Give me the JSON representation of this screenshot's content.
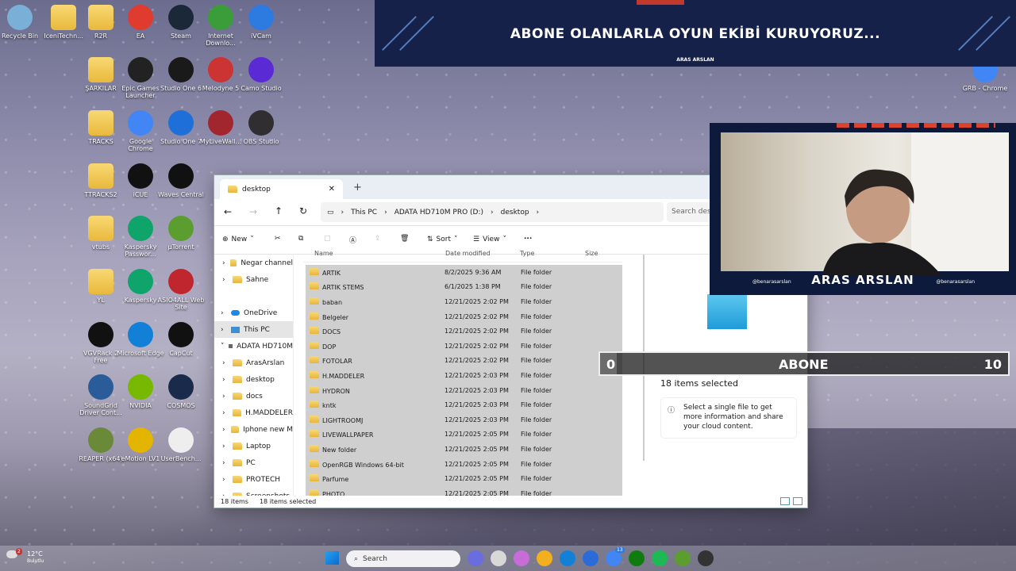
{
  "desktop_icons": [
    {
      "label": "Recycle Bin",
      "color": "#7ab0d8"
    },
    {
      "label": "IceniTechn...",
      "color": "folder"
    },
    {
      "label": "R2R",
      "color": "folder"
    },
    {
      "label": "EA",
      "color": "#e03b2f"
    },
    {
      "label": "Steam",
      "color": "#1b2838"
    },
    {
      "label": "Internet Downlo...",
      "color": "#3a9d3a"
    },
    {
      "label": "iVCam",
      "color": "#2d7be0"
    },
    {
      "label": "ŞARKILAR",
      "color": "folder"
    },
    {
      "label": "Epic Games Launcher",
      "color": "#222222"
    },
    {
      "label": "Studio One 6",
      "color": "#1a1a1a"
    },
    {
      "label": "Melodyne 5",
      "color": "#c33"
    },
    {
      "label": "Camo Studio",
      "color": "#5a2bd4"
    },
    {
      "label": "TRACKS",
      "color": "folder"
    },
    {
      "label": "Google Chrome",
      "color": "#4285f4"
    },
    {
      "label": "Studio One 7",
      "color": "#1e6fd8"
    },
    {
      "label": "MyLiveWall...",
      "color": "#a2262d"
    },
    {
      "label": "OBS Studio",
      "color": "#302e31"
    },
    {
      "label": "TTRACKS2",
      "color": "folder"
    },
    {
      "label": "iCUE",
      "color": "#111111"
    },
    {
      "label": "Waves Central",
      "color": "#111111"
    },
    {
      "label": "vtubs",
      "color": "folder"
    },
    {
      "label": "Kaspersky Passwor...",
      "color": "#0ea46a"
    },
    {
      "label": "µTorrent",
      "color": "#5b9e2f"
    },
    {
      "label": "YL",
      "color": "folder"
    },
    {
      "label": "Kaspersky",
      "color": "#0ea46a"
    },
    {
      "label": "ASIO4ALL Web Site",
      "color": "#c0262d"
    },
    {
      "label": "VGVRack 2 Free",
      "color": "#111111"
    },
    {
      "label": "Microsoft Edge",
      "color": "#1380d8"
    },
    {
      "label": "CapCut",
      "color": "#111111"
    },
    {
      "label": "SoundGrid Driver Cont...",
      "color": "#2a5c9a"
    },
    {
      "label": "NVIDIA",
      "color": "#76b900"
    },
    {
      "label": "COSMOS",
      "color": "#1a2a4a"
    },
    {
      "label": "REAPER (x64)",
      "color": "#6a8a3a"
    },
    {
      "label": "eMotion LV1",
      "color": "#e3b400"
    },
    {
      "label": "UserBench...",
      "color": "#eeeeee"
    },
    {
      "label": "GRB - Chrome",
      "color": "#4285f4"
    }
  ],
  "banner": {
    "text": "ABONE OLANLARLA OYUN EKİBİ KURUYORUZ...",
    "name": "ARAS ARSLAN"
  },
  "explorer": {
    "tab_title": "desktop",
    "breadcrumb": [
      "This PC",
      "ADATA HD710M PRO (D:)",
      "desktop"
    ],
    "search_placeholder": "Search desk",
    "toolbar": {
      "new": "New",
      "sort": "Sort",
      "view": "View",
      "more": "..."
    },
    "columns": [
      "Name",
      "Date modified",
      "Type",
      "Size"
    ],
    "sidebar": [
      {
        "label": "Negar channel",
        "indent": 1
      },
      {
        "label": "Sahne",
        "indent": 1
      },
      {
        "label": "",
        "indent": 0
      },
      {
        "label": "OneDrive",
        "indent": 0,
        "icon": "cloud"
      },
      {
        "label": "This PC",
        "indent": 0,
        "icon": "pc",
        "selected": true
      },
      {
        "label": "ADATA HD710M",
        "indent": 0,
        "icon": "drive",
        "expanded": true
      },
      {
        "label": "ArasArslan",
        "indent": 1
      },
      {
        "label": "desktop",
        "indent": 1
      },
      {
        "label": "docs",
        "indent": 1
      },
      {
        "label": "H.MADDELER",
        "indent": 1
      },
      {
        "label": "Iphone new M",
        "indent": 1
      },
      {
        "label": "Laptop",
        "indent": 1
      },
      {
        "label": "PC",
        "indent": 1
      },
      {
        "label": "PROTECH",
        "indent": 1
      },
      {
        "label": "Screenshots",
        "indent": 1
      }
    ],
    "rows": [
      {
        "name": "ARTIK",
        "date": "8/2/2025 9:36 AM",
        "type": "File folder"
      },
      {
        "name": "ARTIK STEMS",
        "date": "6/1/2025 1:38 PM",
        "type": "File folder"
      },
      {
        "name": "baban",
        "date": "12/21/2025 2:02 PM",
        "type": "File folder"
      },
      {
        "name": "Belgeler",
        "date": "12/21/2025 2:02 PM",
        "type": "File folder"
      },
      {
        "name": "DOCS",
        "date": "12/21/2025 2:02 PM",
        "type": "File folder"
      },
      {
        "name": "DOP",
        "date": "12/21/2025 2:02 PM",
        "type": "File folder"
      },
      {
        "name": "FOTOLAR",
        "date": "12/21/2025 2:02 PM",
        "type": "File folder"
      },
      {
        "name": "H.MADDELER",
        "date": "12/21/2025 2:03 PM",
        "type": "File folder"
      },
      {
        "name": "HYDRON",
        "date": "12/21/2025 2:03 PM",
        "type": "File folder"
      },
      {
        "name": "kntk",
        "date": "12/21/2025 2:03 PM",
        "type": "File folder"
      },
      {
        "name": "LIGHTROOMJ",
        "date": "12/21/2025 2:03 PM",
        "type": "File folder"
      },
      {
        "name": "LIVEWALLPAPER",
        "date": "12/21/2025 2:05 PM",
        "type": "File folder"
      },
      {
        "name": "New folder",
        "date": "12/21/2025 2:05 PM",
        "type": "File folder"
      },
      {
        "name": "OpenRGB Windows 64-bit",
        "date": "12/21/2025 2:05 PM",
        "type": "File folder"
      },
      {
        "name": "Parfume",
        "date": "12/21/2025 2:05 PM",
        "type": "File folder"
      },
      {
        "name": "PHOTO",
        "date": "12/21/2025 2:05 PM",
        "type": "File folder"
      }
    ],
    "details": {
      "selected": "18 items selected",
      "info": "Select a single file to get more information and share your cloud content."
    },
    "status": {
      "items": "18 items",
      "selected": "18 items selected"
    }
  },
  "camera": {
    "name": "ARAS ARSLAN",
    "handle_left": "@benarasarslan",
    "handle_right": "@benarasarslan"
  },
  "subgoal": {
    "current": "0",
    "label": "ABONE",
    "target": "10"
  },
  "taskbar": {
    "search": "Search",
    "weather": "12°C",
    "weather_sub": "Bulutlu",
    "notif": "2",
    "badge": "13"
  }
}
